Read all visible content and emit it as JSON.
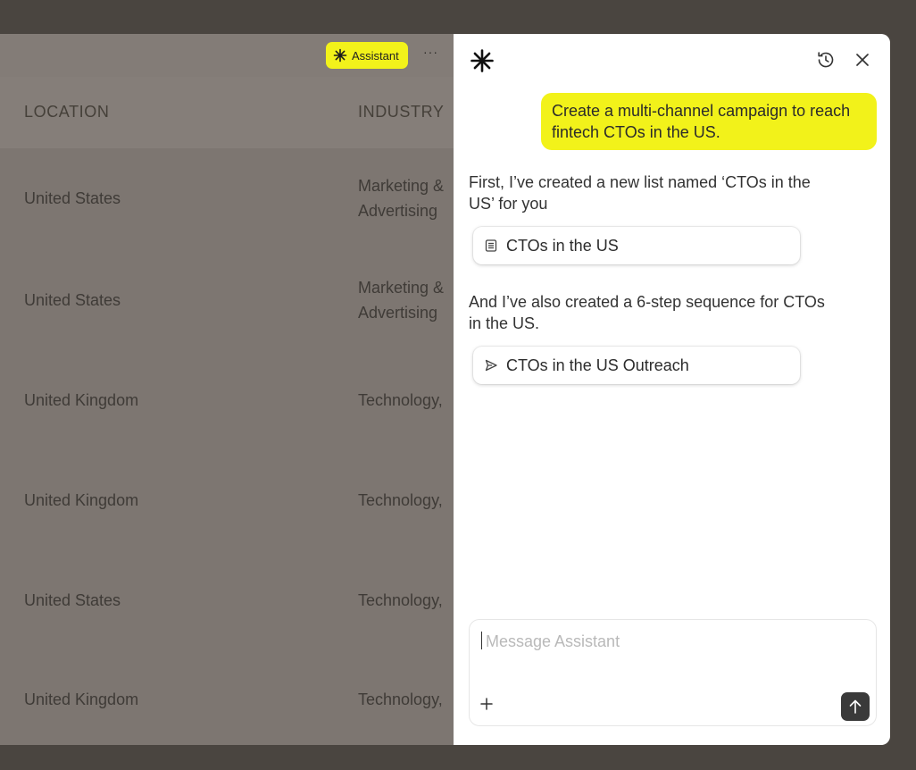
{
  "app": {
    "assistant_button_label": "Assistant",
    "more_label": "···",
    "columns": [
      "LOCATION",
      "INDUSTRY"
    ],
    "rows": [
      {
        "location": "United States",
        "industry": "Marketing &\nAdvertising"
      },
      {
        "location": "United States",
        "industry": "Marketing &\nAdvertising"
      },
      {
        "location": "United Kingdom",
        "industry": "Technology,"
      },
      {
        "location": "United Kingdom",
        "industry": "Technology,"
      },
      {
        "location": "United States",
        "industry": "Technology,"
      },
      {
        "location": "United Kingdom",
        "industry": "Technology,"
      }
    ]
  },
  "assistant": {
    "user_message": "Create a multi-channel campaign to reach fintech CTOs in the US.",
    "reply_1": "First, I’ve created a new list named ‘CTOs in the US’ for you",
    "list_chip_label": "CTOs in the US",
    "reply_2": "And I’ve also created a 6-step sequence for CTOs in the US.",
    "sequence_chip_label": "CTOs in the US Outreach",
    "input_placeholder": "Message Assistant",
    "input_value": ""
  },
  "colors": {
    "accent_yellow": "#f2f21a",
    "send_button": "#3a3a3a",
    "overlay_background": "#7d7671"
  },
  "icons": [
    "sparkle-icon",
    "more-icon",
    "logo-sparkle-icon",
    "history-icon",
    "close-icon",
    "list-icon",
    "send-arrow-icon",
    "plus-icon",
    "arrow-up-icon"
  ]
}
